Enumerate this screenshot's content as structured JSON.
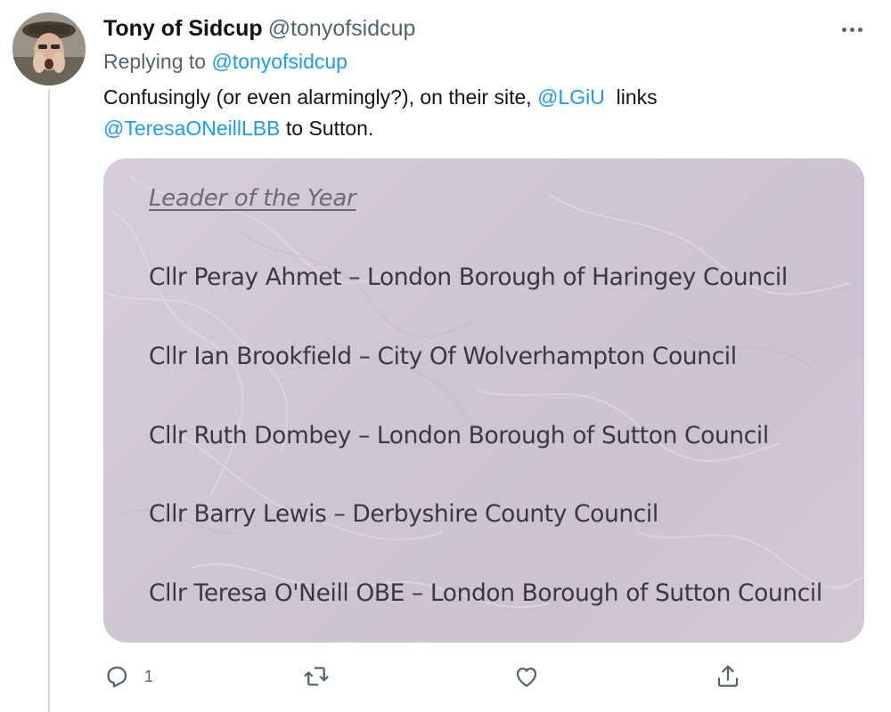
{
  "tweet": {
    "author_name": "Tony of Sidcup",
    "author_handle": "@tonyofsidcup",
    "replying_prefix": "Replying to ",
    "replying_handle": "@tonyofsidcup",
    "text_part1": "Confusingly (or even alarmingly?), on their site, ",
    "mention1": "@LGiU",
    "text_part2": "  links",
    "mention2": "@TeresaONeillLBB",
    "text_part3": " to Sutton."
  },
  "image_card": {
    "title": "Leader of the Year",
    "entries": [
      "Cllr Peray Ahmet – London Borough of Haringey Council",
      "Cllr Ian Brookfield – City Of Wolverhampton Council",
      "Cllr Ruth Dombey – London Borough of Sutton Council",
      "Cllr Barry Lewis – Derbyshire County Council",
      "Cllr Teresa O'Neill OBE – London Borough of Sutton Council"
    ]
  },
  "actions": {
    "reply_icon": "reply-icon",
    "reply_count": "1",
    "retweet_icon": "retweet-icon",
    "like_icon": "heart-icon",
    "share_icon": "share-icon"
  },
  "colors": {
    "link": "#1d9bf0",
    "secondary_text": "#536471",
    "card_background": "#d3cad8"
  }
}
